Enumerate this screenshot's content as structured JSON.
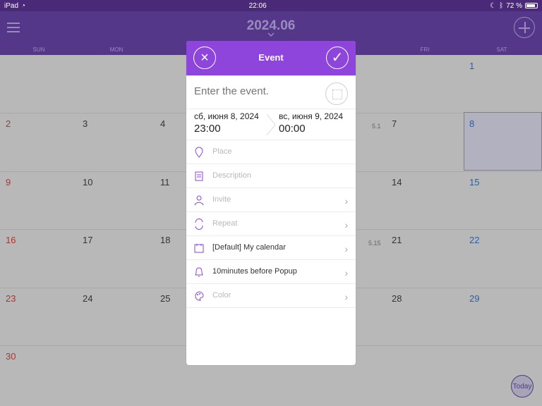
{
  "status": {
    "device": "iPad",
    "time": "22:06",
    "battery_text": "72 %",
    "battery_level": 0.72
  },
  "header": {
    "title": "2024.06"
  },
  "weekdays": [
    "SUN",
    "MON",
    "",
    "",
    "",
    "FRI",
    "SAT"
  ],
  "calendar": {
    "weeks": [
      [
        "",
        "",
        "",
        "",
        "",
        "",
        "1"
      ],
      [
        "2",
        "3",
        "4",
        "",
        "",
        "7",
        "8"
      ],
      [
        "9",
        "10",
        "11",
        "",
        "",
        "14",
        "15"
      ],
      [
        "16",
        "17",
        "18",
        "",
        "",
        "21",
        "22"
      ],
      [
        "23",
        "24",
        "25",
        "",
        "",
        "28",
        "29"
      ],
      [
        "30",
        "",
        "",
        "",
        "",
        "",
        ""
      ]
    ],
    "notes": {
      "w1": "5.1",
      "w3": "5.15"
    }
  },
  "modal": {
    "title": "Event",
    "event_placeholder": "Enter the event.",
    "start": {
      "date": "сб, июня 8, 2024",
      "time": "23:00"
    },
    "end": {
      "date": "вс, июня 9, 2024",
      "time": "00:00"
    },
    "place": "Place",
    "description": "Description",
    "invite": "Invite",
    "repeat": "Repeat",
    "calendar": "[Default] My calendar",
    "reminder": "10minutes before Popup",
    "color": "Color"
  },
  "today_label": "Today",
  "colors": {
    "primary": "#8e45dc",
    "header": "#55378a",
    "sunday": "#b3332e",
    "saturday": "#2f5e9f"
  }
}
